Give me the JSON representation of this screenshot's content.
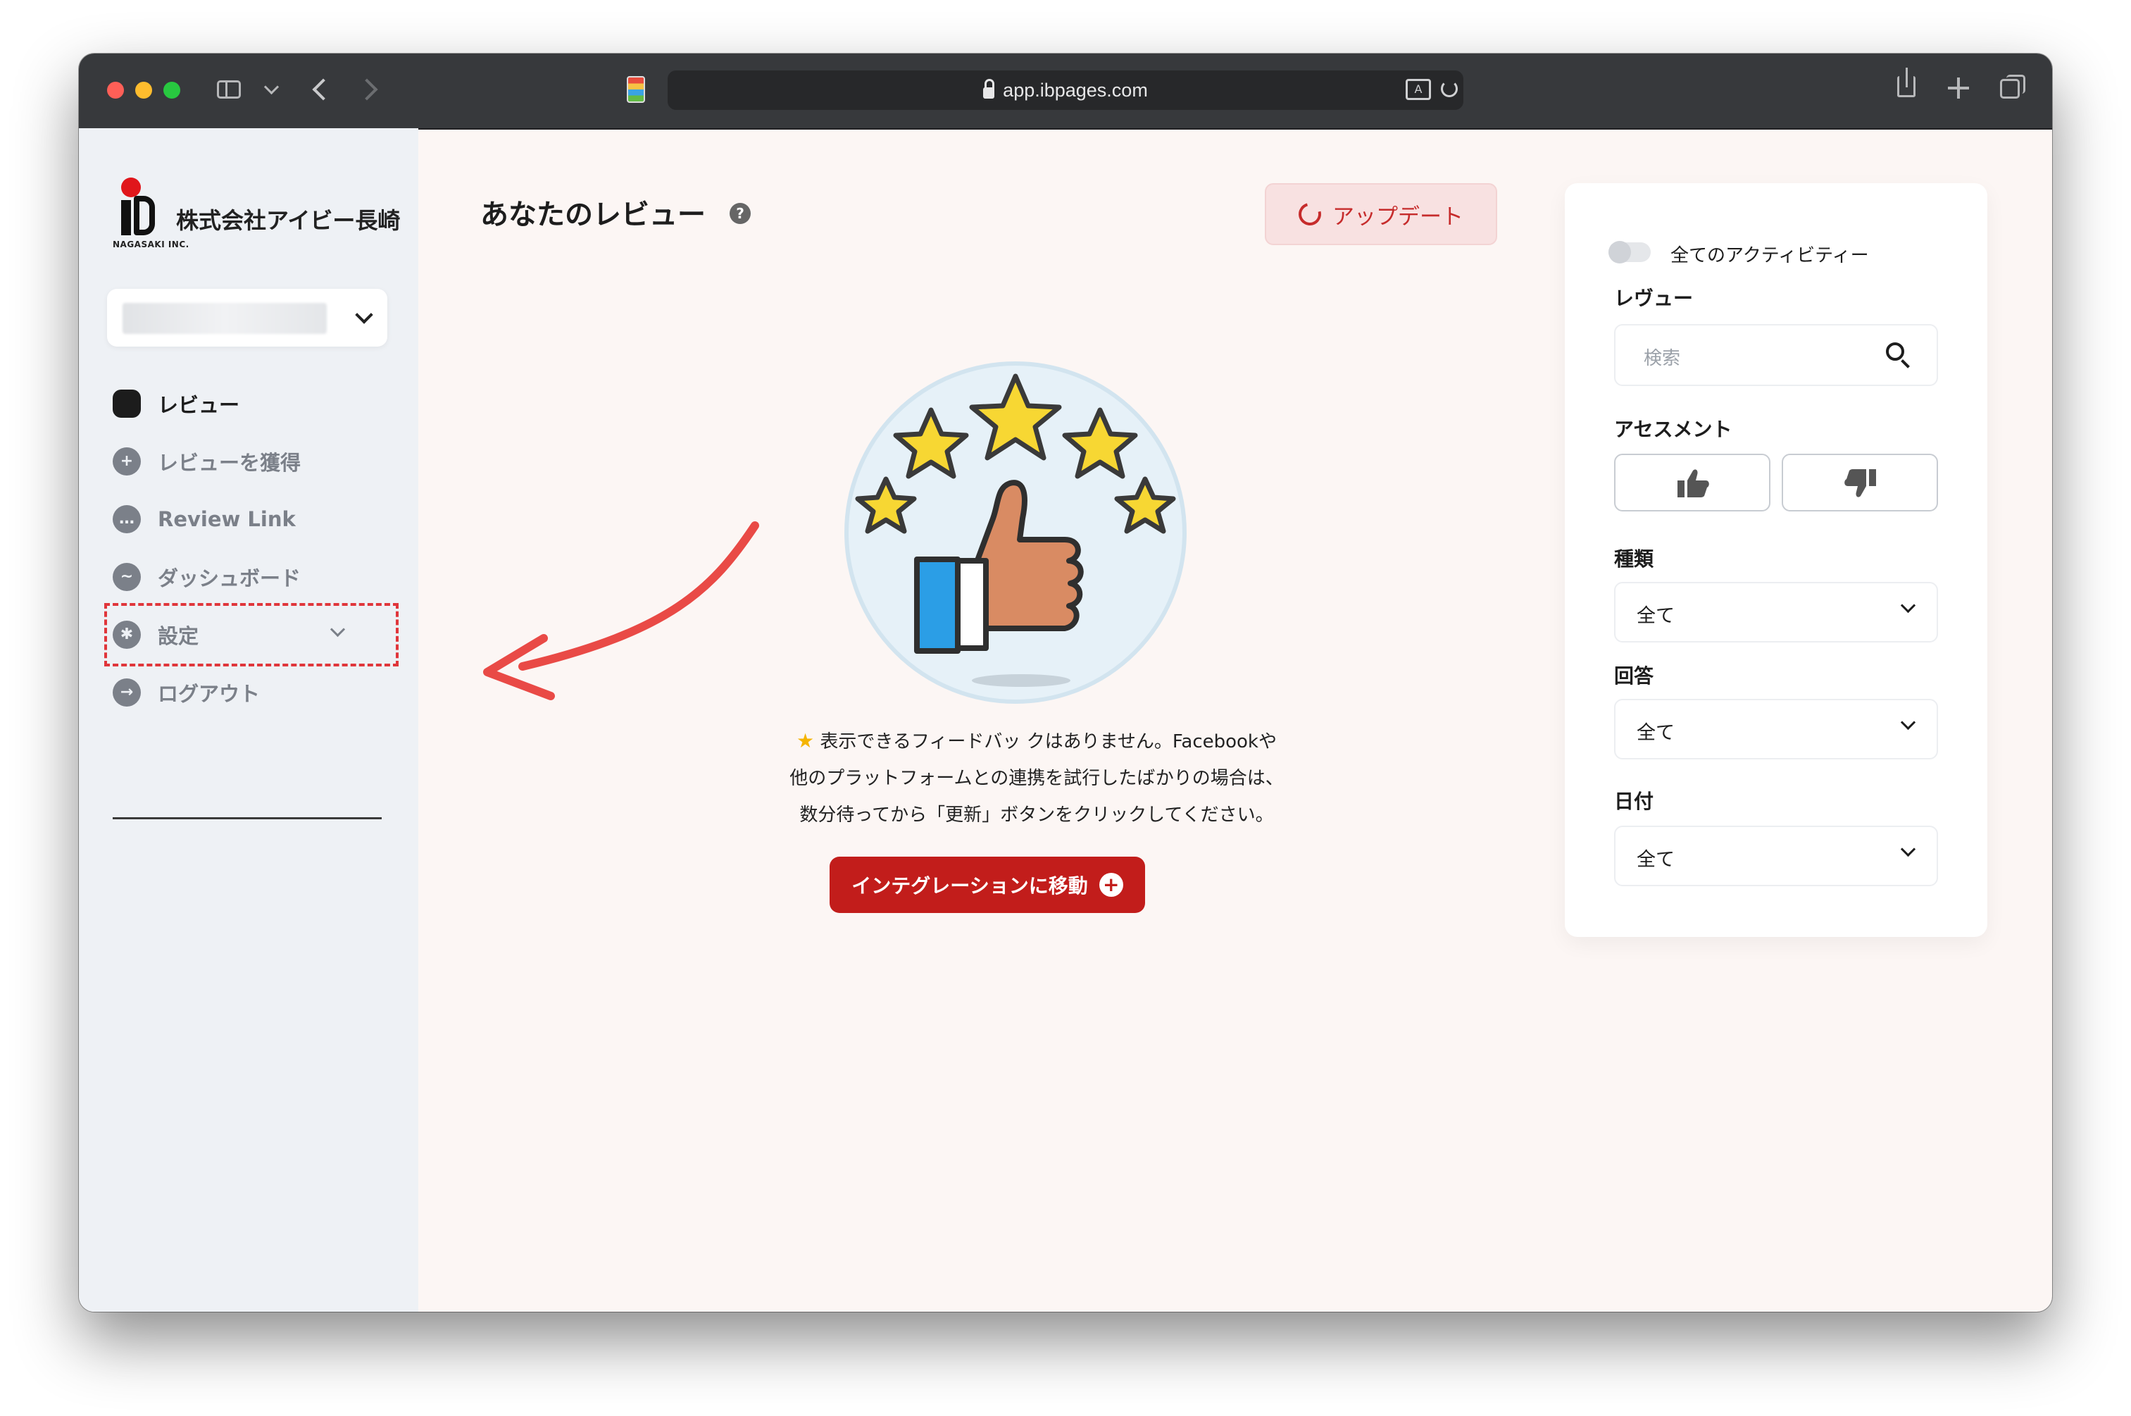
{
  "browser": {
    "url": "app.ibpages.com"
  },
  "sidebar": {
    "logo": {
      "company_name": "株式会社アイビー長崎",
      "sub_text": "NAGASAKI INC."
    },
    "items": [
      {
        "label": "レビュー",
        "icon": "star-badge-icon",
        "active": true
      },
      {
        "label": "レビューを獲得",
        "icon": "plus-circle-icon",
        "active": false
      },
      {
        "label": "Review Link",
        "icon": "chat-bubble-icon",
        "active": false
      },
      {
        "label": "ダッシュボード",
        "icon": "chart-line-icon",
        "active": false
      },
      {
        "label": "設定",
        "icon": "gear-icon",
        "active": false,
        "highlighted": true
      },
      {
        "label": "ログアウト",
        "icon": "logout-arrow-icon",
        "active": false
      }
    ]
  },
  "main": {
    "title": "あなたのレビュー",
    "update_button": "アップデート",
    "empty_message": {
      "line1": "表示できるフィードバッ クはありません。Facebookや",
      "line2": "他のプラットフォームとの連携を試行したばかりの場合は、",
      "line3": "数分待ってから「更新」ボタンをクリックしてください。"
    },
    "integration_button": "インテグレーションに移動"
  },
  "filters": {
    "all_activity_label": "全てのアクティビティー",
    "review_label": "レヴュー",
    "search_placeholder": "検索",
    "assessment_label": "アセスメント",
    "type_label": "種類",
    "type_value": "全て",
    "reply_label": "回答",
    "reply_value": "全て",
    "date_label": "日付",
    "date_value": "全て"
  },
  "colors": {
    "accent_red": "#c21d1b",
    "highlight_dashed": "#e0363b",
    "sidebar_bg": "#eef1f5",
    "page_bg": "#fcf6f4"
  }
}
